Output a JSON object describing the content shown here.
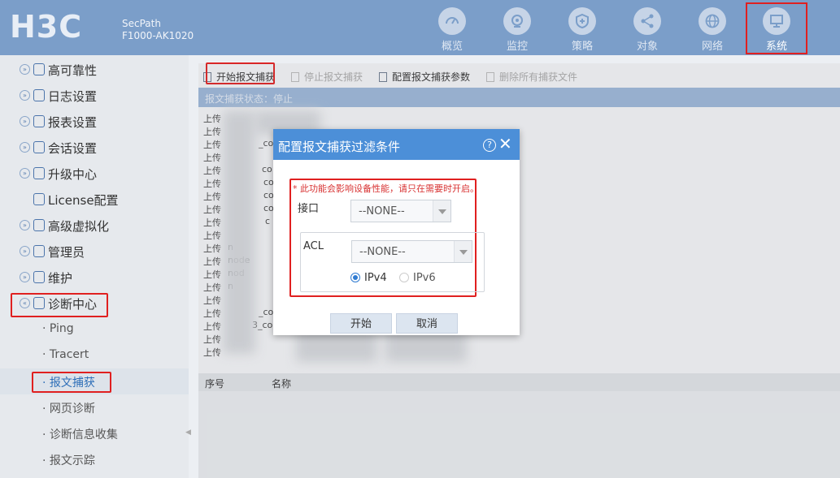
{
  "header": {
    "logo": "H3C",
    "product_line1": "SecPath",
    "product_line2": "F1000-AK1020",
    "nav": [
      {
        "label": "概览",
        "icon": "gauge-icon"
      },
      {
        "label": "监控",
        "icon": "camera-icon"
      },
      {
        "label": "策略",
        "icon": "shield-icon"
      },
      {
        "label": "对象",
        "icon": "share-icon"
      },
      {
        "label": "网络",
        "icon": "globe-icon"
      },
      {
        "label": "系统",
        "icon": "monitor-icon",
        "active": true
      }
    ]
  },
  "sidebar": {
    "items": [
      {
        "label": "高可靠性"
      },
      {
        "label": "日志设置"
      },
      {
        "label": "报表设置"
      },
      {
        "label": "会话设置"
      },
      {
        "label": "升级中心"
      },
      {
        "label": "License配置"
      },
      {
        "label": "高级虚拟化"
      },
      {
        "label": "管理员"
      },
      {
        "label": "维护"
      },
      {
        "label": "诊断中心"
      }
    ],
    "subitems": [
      {
        "label": "· Ping"
      },
      {
        "label": "· Tracert"
      },
      {
        "label": "· 报文捕获",
        "active": true
      },
      {
        "label": "· 网页诊断"
      },
      {
        "label": "· 诊断信息收集"
      },
      {
        "label": "· 报文示踪"
      }
    ]
  },
  "toolbar": {
    "start_capture": "开始报文捕获",
    "stop_capture": "停止报文捕获",
    "config_params": "配置报文捕获参数",
    "delete_files": "删除所有捕获文件"
  },
  "status": {
    "text": "报文捕获状态：停止"
  },
  "log": {
    "prefix": "上传",
    "lines": [
      "上传",
      "上传",
      "上传",
      "上传",
      "上传",
      "上传",
      "上传",
      "上传",
      "上传",
      "上传",
      "上传",
      "上传",
      "上传",
      "上传",
      "上传",
      "上传",
      "上传",
      "上传",
      "上传"
    ],
    "fragments": [
      "_co",
      "co",
      "co",
      "co",
      "co",
      "c",
      "n",
      "node",
      "nod",
      "n",
      "_co",
      "3_co"
    ]
  },
  "table": {
    "col_index": "序号",
    "col_name": "名称"
  },
  "dialog": {
    "title": "配置报文捕获过滤条件",
    "help": "?",
    "close": "✕",
    "warning": "* 此功能会影响设备性能，请只在需要时开启。",
    "interface_label": "接口",
    "interface_value": "--NONE--",
    "acl_label": "ACL",
    "acl_value": "--NONE--",
    "ipv4_label": "IPv4",
    "ipv6_label": "IPv6",
    "ip_version_selected": "IPv4",
    "start_button": "开始",
    "cancel_button": "取消"
  },
  "colors": {
    "header_bg": "#7b9ec9",
    "accent": "#4c8fd8",
    "highlight": "#e02020",
    "warning_text": "#d83232"
  }
}
